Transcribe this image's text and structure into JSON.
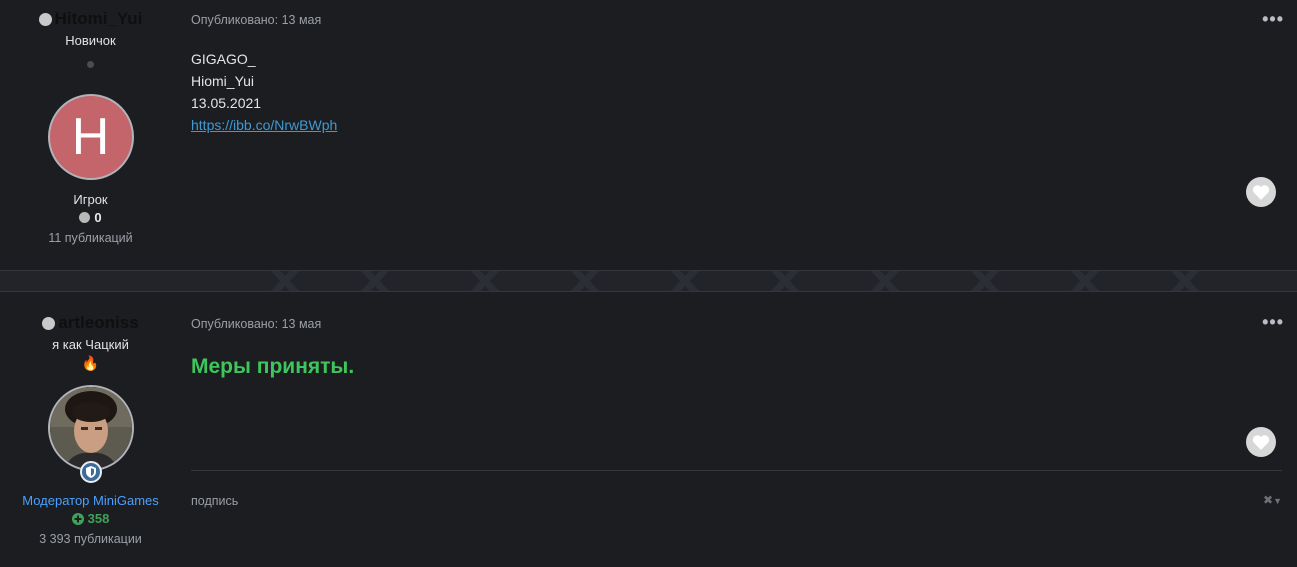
{
  "posts": [
    {
      "author": {
        "name": "Hitomi_Yui",
        "title": "Новичок",
        "avatar_letter": "H",
        "group": "Игрок",
        "reputation": "0",
        "post_count": "11 публикаций"
      },
      "meta": "Опубликовано: 13 мая",
      "menu": "•••",
      "lines": [
        "GIGAGO_",
        "Hiomi_Yui",
        "13.05.2021"
      ],
      "link": "https://ibb.co/NrwBWph"
    },
    {
      "author": {
        "name": "artleoniss",
        "title": "я как Чацкий",
        "emoji": "🔥",
        "group": "Модератор MiniGames",
        "reputation": "358",
        "post_count": "3 393 публикации"
      },
      "meta": "Опубликовано: 13 мая",
      "menu": "•••",
      "message": "Меры приняты.",
      "signature_label": "подпись"
    }
  ],
  "colors": {
    "background": "#1c1d21",
    "link": "#3e9ad6",
    "moderator": "#4aa0ff",
    "message_green": "#3ec65c",
    "rep_positive": "#3fa25a",
    "avatar_h": "#c4646b"
  },
  "icons": {
    "online_status": "status-dot-icon",
    "like": "heart-icon",
    "moderator_badge": "shield-icon",
    "rep_plus": "plus-circle-icon",
    "signature_hide": "close-icon"
  }
}
